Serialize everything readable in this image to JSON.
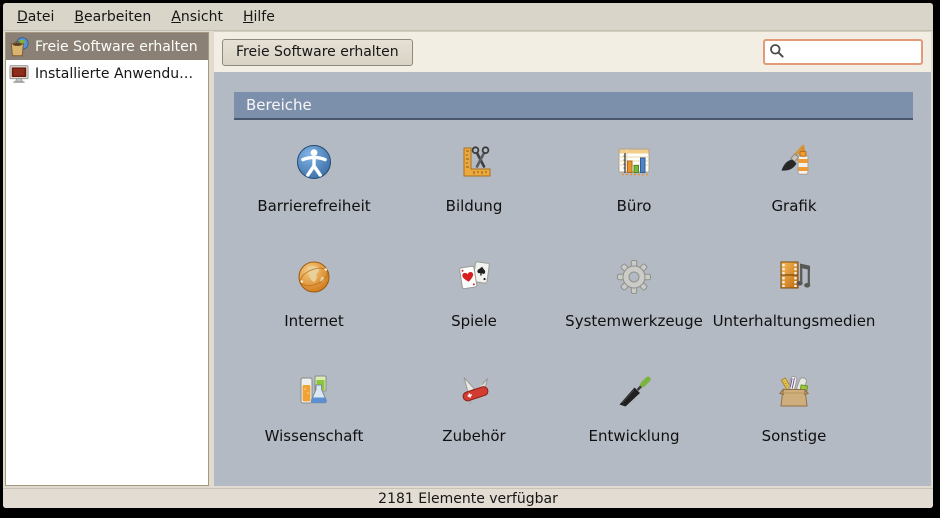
{
  "menubar": {
    "items": [
      {
        "accel": "D",
        "rest": "atei"
      },
      {
        "accel": "B",
        "rest": "earbeiten"
      },
      {
        "accel": "A",
        "rest": "nsicht"
      },
      {
        "accel": "H",
        "rest": "ilfe"
      }
    ]
  },
  "sidebar": {
    "items": [
      {
        "label": "Freie Software erhalten",
        "icon": "get-free-software-icon",
        "selected": true
      },
      {
        "label": "Installierte Anwendu…",
        "icon": "installed-applications-icon",
        "selected": false
      }
    ]
  },
  "toolbar": {
    "breadcrumb_button_label": "Freie Software erhalten",
    "search": {
      "value": "",
      "placeholder": "",
      "icon": "search-icon"
    }
  },
  "main": {
    "section_header": "Bereiche",
    "categories": [
      {
        "label": "Barrierefreiheit",
        "icon": "accessibility-icon"
      },
      {
        "label": "Bildung",
        "icon": "education-icon"
      },
      {
        "label": "Büro",
        "icon": "office-icon"
      },
      {
        "label": "Grafik",
        "icon": "graphics-icon"
      },
      {
        "label": "Internet",
        "icon": "internet-icon"
      },
      {
        "label": "Spiele",
        "icon": "games-icon"
      },
      {
        "label": "Systemwerkzeuge",
        "icon": "system-tools-icon"
      },
      {
        "label": "Unterhaltungsmedien",
        "icon": "media-icon"
      },
      {
        "label": "Wissenschaft",
        "icon": "science-icon"
      },
      {
        "label": "Zubehör",
        "icon": "accessories-icon"
      },
      {
        "label": "Entwicklung",
        "icon": "development-icon"
      },
      {
        "label": "Sonstige",
        "icon": "other-icon"
      }
    ]
  },
  "statusbar": {
    "text": "2181 Elemente verfügbar"
  },
  "colors": {
    "content_bg": "#b4bac3",
    "section_header_bg": "#7d90ab",
    "selected_item_bg": "#8b8075",
    "search_focus_border": "#e39a78",
    "toolbar_bg": "#f2eee4",
    "chrome_bg": "#e0dacf",
    "statusbar_bg": "#e2dcd2"
  }
}
